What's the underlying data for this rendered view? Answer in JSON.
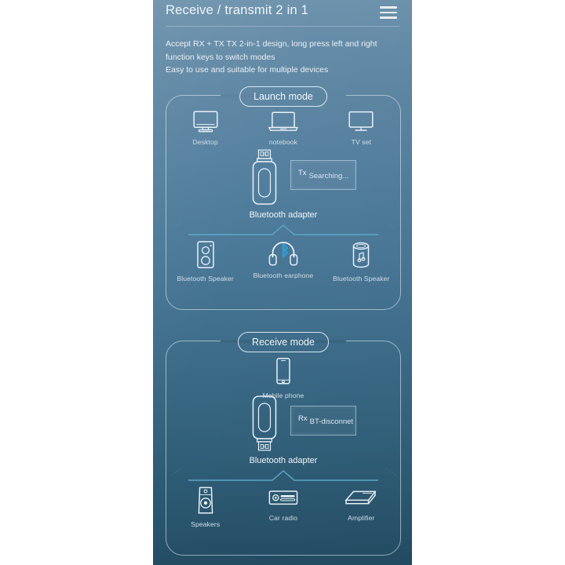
{
  "header": {
    "title": "Receive / transmit 2 in 1",
    "menu_icon": "hamburger-menu-icon",
    "subtitle_line1": "Accept RX + TX TX 2-in-1 design, long press left and right",
    "subtitle_line2": "function keys to switch modes",
    "subtitle_line3": "Easy to use and suitable for multiple devices"
  },
  "colors": {
    "bg_top": "#6e93ad",
    "bg_bottom": "#234c63",
    "outline": "#dfe9f0",
    "text_primary": "#f0f5f8",
    "text_caption": "#d3dee6",
    "accent_line": "#5ba8c9",
    "bluetooth_blue": "#2f9fd6"
  },
  "launch_mode": {
    "label": "Launch mode",
    "top_devices": [
      {
        "caption": "Desktop",
        "icon": "desktop-monitor-icon"
      },
      {
        "caption": "notebook",
        "icon": "laptop-icon"
      },
      {
        "caption": "TV set",
        "icon": "tv-icon"
      }
    ],
    "adapter": {
      "icon": "usb-bluetooth-adapter-icon",
      "name": "Bluetooth adapter",
      "mode_tag": "Tx",
      "status": "Searching..."
    },
    "bottom_devices": [
      {
        "caption": "Bluetooth Speaker",
        "icon": "box-speaker-icon"
      },
      {
        "caption": "Bluetooth earphone",
        "icon": "bluetooth-headphones-icon"
      },
      {
        "caption": "Bluetooth Speaker",
        "icon": "cylinder-speaker-icon"
      }
    ]
  },
  "receive_mode": {
    "label": "Receive mode",
    "top_devices": [
      {
        "caption": "Mobile phone",
        "icon": "mobile-phone-icon"
      }
    ],
    "adapter": {
      "icon": "usb-bluetooth-adapter-icon-flipped",
      "name": "Bluetooth adapter",
      "mode_tag": "Rx",
      "status": "BT-disconnet"
    },
    "bottom_devices": [
      {
        "caption": "Speakers",
        "icon": "studio-speaker-icon"
      },
      {
        "caption": "Car radio",
        "icon": "car-stereo-icon"
      },
      {
        "caption": "Amplifier",
        "icon": "amplifier-box-icon"
      }
    ]
  }
}
